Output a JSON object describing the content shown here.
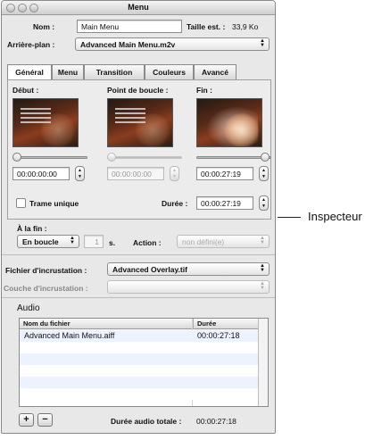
{
  "window": {
    "title": "Menu"
  },
  "header": {
    "name_label": "Nom :",
    "name_value": "Main Menu",
    "size_label": "Taille est. :",
    "size_value": "33,9 Ko",
    "background_label": "Arrière-plan :",
    "background_value": "Advanced Main Menu.m2v"
  },
  "tabs": [
    {
      "label": "Général",
      "active": true
    },
    {
      "label": "Menu",
      "active": false
    },
    {
      "label": "Transition",
      "active": false
    },
    {
      "label": "Couleurs",
      "active": false
    },
    {
      "label": "Avancé",
      "active": false
    }
  ],
  "general": {
    "start_label": "Début :",
    "loop_label": "Point de boucle :",
    "end_label": "Fin :",
    "start_tc": "00:00:00:00",
    "loop_tc": "00:00:00:00",
    "end_tc": "00:00:27:19",
    "still_label": "Trame unique",
    "duration_label": "Durée :",
    "duration_value": "00:00:27:19"
  },
  "at_end": {
    "label": "À la fin :",
    "mode": "En boucle",
    "count": "1",
    "unit": "s.",
    "action_label": "Action :",
    "action_value": "non défini(e)"
  },
  "overlay": {
    "file_label": "Fichier d'incrustation :",
    "file_value": "Advanced Overlay.tif",
    "layer_label": "Couche d'incrustation :",
    "layer_value": ""
  },
  "audio": {
    "section_label": "Audio",
    "columns": [
      "Nom du fichier",
      "Durée"
    ],
    "rows": [
      {
        "name": "Advanced Main Menu.aiff",
        "duration": "00:00:27:18"
      }
    ],
    "add_label": "+",
    "remove_label": "−",
    "total_label": "Durée audio totale :",
    "total_value": "00:00:27:18"
  },
  "callout": {
    "label": "Inspecteur"
  },
  "colors": {
    "window_bg": "#e8e8e8",
    "alt_row": "#edf3fe"
  }
}
